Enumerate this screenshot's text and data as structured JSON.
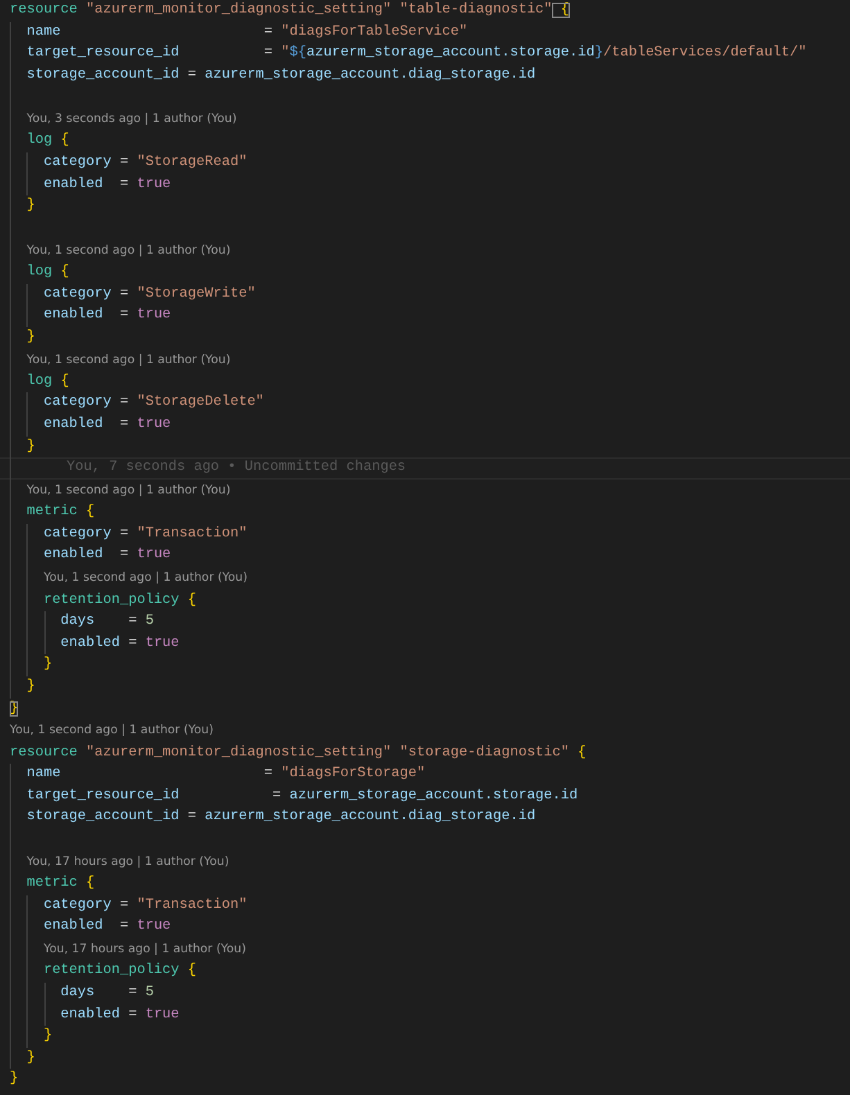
{
  "editor": {
    "lines": [
      {
        "kind": "code",
        "parts": [
          {
            "keyword": "resource"
          },
          {
            "string": " \"azurerm_monitor_diagnostic_setting\""
          },
          {
            "string": " \"table-diagnostic\""
          },
          {
            "brace": " {",
            "matched": true
          }
        ]
      },
      {
        "kind": "code",
        "parts": [
          {
            "attribute": "  name"
          },
          {
            "op": "                        = "
          },
          {
            "string": "\"diagsForTableService\""
          }
        ]
      },
      {
        "kind": "code",
        "parts": [
          {
            "attribute": "  target_resource_id"
          },
          {
            "op": "          = "
          },
          {
            "string": "\""
          },
          {
            "interp": "${"
          },
          {
            "attribute": "azurerm_storage_account.storage.id"
          },
          {
            "interp": "}"
          },
          {
            "string": "/tableServices/default/\""
          }
        ]
      },
      {
        "kind": "code",
        "parts": [
          {
            "attribute": "  storage_account_id"
          },
          {
            "op": " = "
          },
          {
            "attribute": "azurerm_storage_account.diag_storage.id"
          }
        ]
      },
      {
        "kind": "blank"
      },
      {
        "kind": "code",
        "lens": "You, 3 seconds ago | 1 author (You)",
        "parts": [
          {
            "keyword": "  log"
          },
          {
            "brace": " {"
          }
        ]
      },
      {
        "kind": "code",
        "parts": [
          {
            "attribute": "    category"
          },
          {
            "op": " = "
          },
          {
            "string": "\"StorageRead\""
          }
        ]
      },
      {
        "kind": "code",
        "parts": [
          {
            "attribute": "    enabled"
          },
          {
            "op": "  = "
          },
          {
            "bool": "true"
          }
        ]
      },
      {
        "kind": "code",
        "parts": [
          {
            "brace": "  }"
          }
        ]
      },
      {
        "kind": "blank"
      },
      {
        "kind": "code",
        "lens": "You, 1 second ago | 1 author (You)",
        "parts": [
          {
            "keyword": "  log"
          },
          {
            "brace": " {"
          }
        ]
      },
      {
        "kind": "code",
        "parts": [
          {
            "attribute": "    category"
          },
          {
            "op": " = "
          },
          {
            "string": "\"StorageWrite\""
          }
        ]
      },
      {
        "kind": "code",
        "parts": [
          {
            "attribute": "    enabled"
          },
          {
            "op": "  = "
          },
          {
            "bool": "true"
          }
        ]
      },
      {
        "kind": "code",
        "parts": [
          {
            "brace": "  }"
          }
        ]
      },
      {
        "kind": "code",
        "lens": "You, 1 second ago | 1 author (You)",
        "parts": [
          {
            "keyword": "  log"
          },
          {
            "brace": " {"
          }
        ]
      },
      {
        "kind": "code",
        "parts": [
          {
            "attribute": "    category"
          },
          {
            "op": " = "
          },
          {
            "string": "\"StorageDelete\""
          }
        ]
      },
      {
        "kind": "code",
        "parts": [
          {
            "attribute": "    enabled"
          },
          {
            "op": "  = "
          },
          {
            "bool": "true"
          }
        ]
      },
      {
        "kind": "code",
        "parts": [
          {
            "brace": "  }"
          }
        ]
      },
      {
        "kind": "blame",
        "current": true,
        "text": "You, 7 seconds ago • Uncommitted changes"
      },
      {
        "kind": "code",
        "lens": "You, 1 second ago | 1 author (You)",
        "parts": [
          {
            "keyword": "  metric"
          },
          {
            "brace": " {"
          }
        ]
      },
      {
        "kind": "code",
        "parts": [
          {
            "attribute": "    category"
          },
          {
            "op": " = "
          },
          {
            "string": "\"Transaction\""
          }
        ]
      },
      {
        "kind": "code",
        "parts": [
          {
            "attribute": "    enabled"
          },
          {
            "op": "  = "
          },
          {
            "bool": "true"
          }
        ]
      },
      {
        "kind": "code",
        "lens": "You, 1 second ago | 1 author (You)",
        "parts": [
          {
            "keyword": "    retention_policy"
          },
          {
            "brace": " {"
          }
        ]
      },
      {
        "kind": "code",
        "parts": [
          {
            "attribute": "      days"
          },
          {
            "op": "    = "
          },
          {
            "number": "5"
          }
        ]
      },
      {
        "kind": "code",
        "parts": [
          {
            "attribute": "      enabled"
          },
          {
            "op": " = "
          },
          {
            "bool": "true"
          }
        ]
      },
      {
        "kind": "code",
        "parts": [
          {
            "brace": "    }"
          }
        ]
      },
      {
        "kind": "code",
        "parts": [
          {
            "brace": "  }"
          }
        ]
      },
      {
        "kind": "code",
        "parts": [
          {
            "brace": "}",
            "matched": true
          }
        ]
      },
      {
        "kind": "code",
        "lens": "You, 1 second ago | 1 author (You)",
        "parts": [
          {
            "keyword": "resource"
          },
          {
            "string": " \"azurerm_monitor_diagnostic_setting\""
          },
          {
            "string": " \"storage-diagnostic\""
          },
          {
            "brace": " {"
          }
        ]
      },
      {
        "kind": "code",
        "parts": [
          {
            "attribute": "  name"
          },
          {
            "op": "                        = "
          },
          {
            "string": "\"diagsForStorage\""
          }
        ]
      },
      {
        "kind": "code",
        "parts": [
          {
            "attribute": "  target_resource_id"
          },
          {
            "op": "           = "
          },
          {
            "attribute": "azurerm_storage_account.storage.id"
          }
        ]
      },
      {
        "kind": "code",
        "parts": [
          {
            "attribute": "  storage_account_id"
          },
          {
            "op": " = "
          },
          {
            "attribute": "azurerm_storage_account.diag_storage.id"
          }
        ]
      },
      {
        "kind": "blank"
      },
      {
        "kind": "code",
        "lens": "You, 17 hours ago | 1 author (You)",
        "parts": [
          {
            "keyword": "  metric"
          },
          {
            "brace": " {"
          }
        ]
      },
      {
        "kind": "code",
        "parts": [
          {
            "attribute": "    category"
          },
          {
            "op": " = "
          },
          {
            "string": "\"Transaction\""
          }
        ]
      },
      {
        "kind": "code",
        "parts": [
          {
            "attribute": "    enabled"
          },
          {
            "op": "  = "
          },
          {
            "bool": "true"
          }
        ]
      },
      {
        "kind": "code",
        "lens": "You, 17 hours ago | 1 author (You)",
        "parts": [
          {
            "keyword": "    retention_policy"
          },
          {
            "brace": " {"
          }
        ]
      },
      {
        "kind": "code",
        "parts": [
          {
            "attribute": "      days"
          },
          {
            "op": "    = "
          },
          {
            "number": "5"
          }
        ]
      },
      {
        "kind": "code",
        "parts": [
          {
            "attribute": "      enabled"
          },
          {
            "op": " = "
          },
          {
            "bool": "true"
          }
        ]
      },
      {
        "kind": "code",
        "parts": [
          {
            "brace": "    }"
          }
        ]
      },
      {
        "kind": "code",
        "parts": [
          {
            "brace": "  }"
          }
        ]
      },
      {
        "kind": "code",
        "parts": [
          {
            "brace": "}"
          }
        ]
      }
    ]
  }
}
